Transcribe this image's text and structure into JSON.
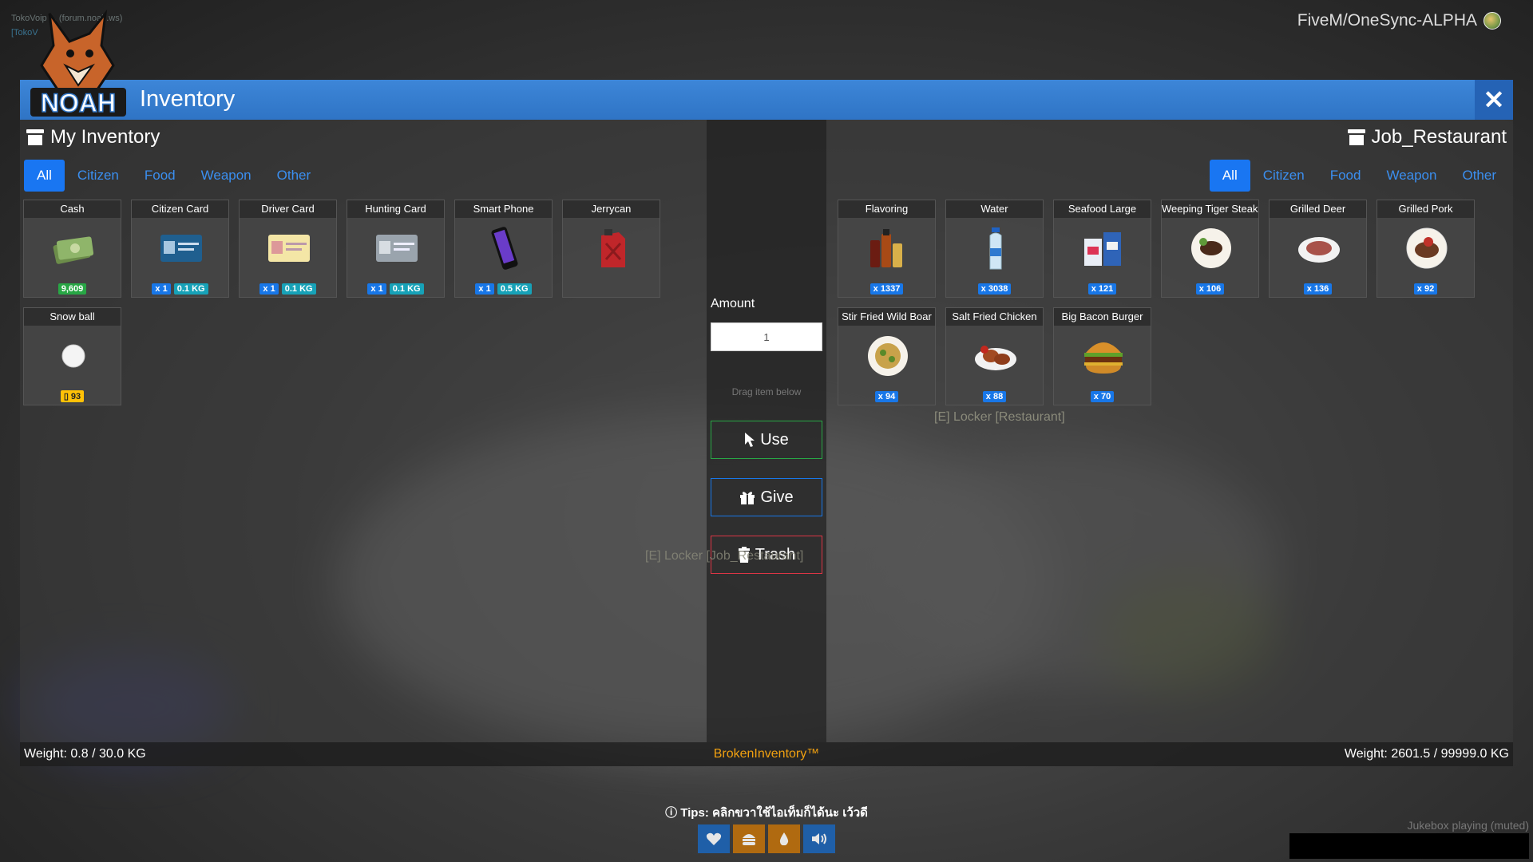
{
  "server": {
    "name": "FiveM/OneSync-ALPHA"
  },
  "window": {
    "title": "Inventory",
    "close_label": "✕"
  },
  "left_panel": {
    "title": "My Inventory",
    "tabs": [
      "All",
      "Citizen",
      "Food",
      "Weapon",
      "Other"
    ],
    "active_tab": "All",
    "items": [
      {
        "name": "Cash",
        "icon": "cash-icon",
        "badges": [
          {
            "text": "9,609",
            "color": "green"
          }
        ]
      },
      {
        "name": "Citizen Card",
        "icon": "id-card-icon",
        "badges": [
          {
            "text": "x 1",
            "color": "blue"
          },
          {
            "text": "0.1 KG",
            "color": "teal"
          }
        ]
      },
      {
        "name": "Driver Card",
        "icon": "driver-card-icon",
        "badges": [
          {
            "text": "x 1",
            "color": "blue"
          },
          {
            "text": "0.1 KG",
            "color": "teal"
          }
        ]
      },
      {
        "name": "Hunting Card",
        "icon": "hunting-card-icon",
        "badges": [
          {
            "text": "x 1",
            "color": "blue"
          },
          {
            "text": "0.1 KG",
            "color": "teal"
          }
        ]
      },
      {
        "name": "Smart Phone",
        "icon": "phone-icon",
        "badges": [
          {
            "text": "x 1",
            "color": "blue"
          },
          {
            "text": "0.5 KG",
            "color": "teal"
          }
        ]
      },
      {
        "name": "Jerrycan",
        "icon": "jerrycan-icon",
        "badges": []
      },
      {
        "name": "Snow ball",
        "icon": "snowball-icon",
        "badges": [
          {
            "text": "▯ 93",
            "color": "yellow"
          }
        ]
      }
    ],
    "weight": "Weight: 0.8 / 30.0 KG"
  },
  "middle": {
    "amount_label": "Amount",
    "amount_value": "1",
    "drag_hint": "Drag item below",
    "use_label": "Use",
    "give_label": "Give",
    "trash_label": "Trash",
    "brand": "BrokenInventory™"
  },
  "right_panel": {
    "title": "Job_Restaurant",
    "tabs": [
      "All",
      "Citizen",
      "Food",
      "Weapon",
      "Other"
    ],
    "active_tab": "All",
    "items": [
      {
        "name": "Flavoring",
        "icon": "flavoring-icon",
        "badges": [
          {
            "text": "x 1337",
            "color": "blue"
          }
        ]
      },
      {
        "name": "Water",
        "icon": "water-bottle-icon",
        "badges": [
          {
            "text": "x 3038",
            "color": "blue"
          }
        ]
      },
      {
        "name": "Seafood Large",
        "icon": "seafood-icon",
        "badges": [
          {
            "text": "x 121",
            "color": "blue"
          }
        ]
      },
      {
        "name": "Weeping Tiger Steaks",
        "icon": "steak-plate-icon",
        "badges": [
          {
            "text": "x 106",
            "color": "blue"
          }
        ]
      },
      {
        "name": "Grilled Deer",
        "icon": "grilled-deer-icon",
        "badges": [
          {
            "text": "x 136",
            "color": "blue"
          }
        ]
      },
      {
        "name": "Grilled Pork",
        "icon": "grilled-pork-icon",
        "badges": [
          {
            "text": "x 92",
            "color": "blue"
          }
        ]
      },
      {
        "name": "Stir Fried Wild Boar",
        "icon": "stir-fry-icon",
        "badges": [
          {
            "text": "x 94",
            "color": "blue"
          }
        ]
      },
      {
        "name": "Salt Fried Chicken",
        "icon": "fried-chicken-icon",
        "badges": [
          {
            "text": "x 88",
            "color": "blue"
          }
        ]
      },
      {
        "name": "Big Bacon Burger",
        "icon": "burger-icon",
        "badges": [
          {
            "text": "x 70",
            "color": "blue"
          }
        ]
      }
    ],
    "weight": "Weight: 2601.5 / 99999.0 KG"
  },
  "world": {
    "locker_hint_1": "[E] Locker [Restaurant]",
    "locker_hint_2": "[E] Locker [Job_Restaurant]"
  },
  "hud": {
    "tips": "Tips: คลิกขวาใช้ไอเท็มก็ได้นะ เว้วดี",
    "status_icons": [
      {
        "icon": "heart-icon",
        "color": "#1f5fa8"
      },
      {
        "icon": "burger-icon",
        "color": "#b06a10"
      },
      {
        "icon": "water-drop-icon",
        "color": "#b06a10"
      },
      {
        "icon": "speaker-icon",
        "color": "#1f5fa8"
      }
    ],
    "jukebox": "Jukebox playing (muted)"
  }
}
